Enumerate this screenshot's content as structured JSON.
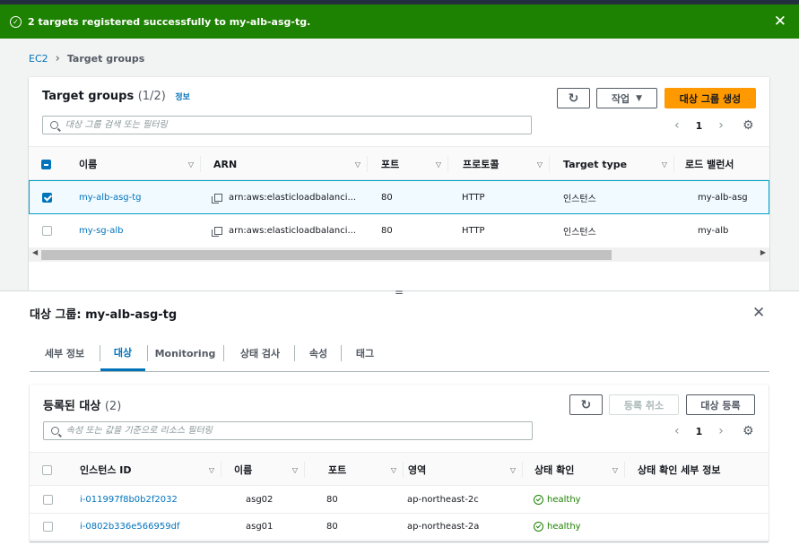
{
  "flash": {
    "message": "2 targets registered successfully to my-alb-asg-tg."
  },
  "breadcrumb": {
    "root": "EC2",
    "current": "Target groups"
  },
  "target_groups": {
    "title": "Target groups",
    "count": "(1/2)",
    "info": "정보",
    "actions_label": "작업",
    "create_label": "대상 그룹 생성",
    "search_placeholder": "대상 그룹 검색 또는 필터링",
    "page": "1",
    "columns": [
      "이름",
      "ARN",
      "포트",
      "프로토콜",
      "Target type",
      "로드 밸런서"
    ],
    "rows": [
      {
        "name": "my-alb-asg-tg",
        "arn": "arn:aws:elasticloadbalanci...",
        "port": "80",
        "protocol": "HTTP",
        "type": "인스턴스",
        "lb": "my-alb-asg",
        "selected": true
      },
      {
        "name": "my-sg-alb",
        "arn": "arn:aws:elasticloadbalanci...",
        "port": "80",
        "protocol": "HTTP",
        "type": "인스턴스",
        "lb": "my-alb",
        "selected": false
      }
    ]
  },
  "detail": {
    "title": "대상 그룹: my-alb-asg-tg",
    "tabs": [
      "세부 정보",
      "대상",
      "Monitoring",
      "상태 검사",
      "속성",
      "태그"
    ],
    "active_tab": "대상"
  },
  "registered": {
    "title": "등록된 대상",
    "count": "(2)",
    "deregister_label": "등록 취소",
    "register_label": "대상 등록",
    "search_placeholder": "속성 또는 값을 기준으로 리소스 필터링",
    "page": "1",
    "columns": [
      "인스턴스 ID",
      "이름",
      "포트",
      "영역",
      "상태 확인",
      "상태 확인 세부 정보"
    ],
    "rows": [
      {
        "id": "i-011997f8b0b2f2032",
        "name": "asg02",
        "port": "80",
        "zone": "ap-northeast-2c",
        "health": "healthy"
      },
      {
        "id": "i-0802b336e566959df",
        "name": "asg01",
        "port": "80",
        "zone": "ap-northeast-2a",
        "health": "healthy"
      }
    ]
  },
  "colors": {
    "success": "#1d8102",
    "link": "#0073bb",
    "primary": "#ff9900"
  }
}
